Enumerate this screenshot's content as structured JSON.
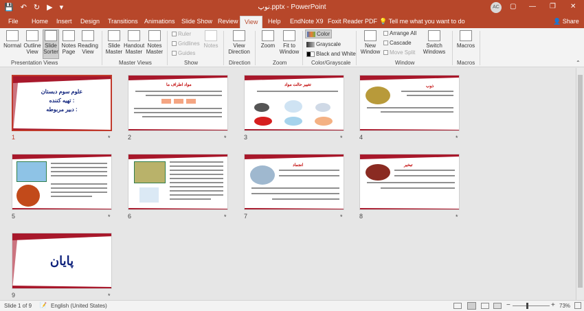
{
  "titlebar": {
    "title": "نوپ.pptx - PowerPoint",
    "user_initials": "AC",
    "minimize": "—",
    "restore": "❐",
    "close": "✕"
  },
  "tabs": {
    "items": [
      "File",
      "Home",
      "Insert",
      "Design",
      "Transitions",
      "Animations",
      "Slide Show",
      "Review",
      "View",
      "Help",
      "EndNote X9",
      "Foxit Reader PDF"
    ],
    "active": "View",
    "tell_me": "Tell me what you want to do",
    "share": "Share"
  },
  "ribbon": {
    "presentation_views": {
      "label": "Presentation Views",
      "buttons": [
        "Normal",
        "Outline View",
        "Slide Sorter",
        "Notes Page",
        "Reading View"
      ]
    },
    "master_views": {
      "label": "Master Views",
      "buttons": [
        "Slide Master",
        "Handout Master",
        "Notes Master"
      ]
    },
    "show": {
      "label": "Show",
      "items": [
        "Ruler",
        "Gridlines",
        "Guides"
      ],
      "notes": "Notes"
    },
    "direction": {
      "label": "Direction",
      "button": "View Direction"
    },
    "zoom": {
      "label": "Zoom",
      "buttons": [
        "Zoom",
        "Fit to Window"
      ]
    },
    "color": {
      "label": "Color/Grayscale",
      "items": [
        "Color",
        "Grayscale",
        "Black and White"
      ]
    },
    "window": {
      "label": "Window",
      "buttons": [
        "New Window",
        "Switch Windows"
      ],
      "items": [
        "Arrange All",
        "Cascade",
        "Move Split"
      ]
    },
    "macros": {
      "label": "Macros",
      "button": "Macros"
    }
  },
  "slides": [
    {
      "num": "1",
      "lines": [
        "علوم سوم دبستان",
        "تهیه کننده :",
        "دبیر مربوطه :"
      ]
    },
    {
      "num": "2",
      "title": "مواد اطراف ما"
    },
    {
      "num": "3",
      "title": "تغییر حالت مواد"
    },
    {
      "num": "4",
      "title": "ذوب"
    },
    {
      "num": "5"
    },
    {
      "num": "6"
    },
    {
      "num": "7",
      "title": "انجماد"
    },
    {
      "num": "8",
      "title": "تبخیر"
    },
    {
      "num": "9",
      "lines": [
        "پایان"
      ]
    }
  ],
  "star": "*",
  "status": {
    "slide_info": "Slide 1 of 9",
    "language": "English (United States)",
    "zoom": "73%",
    "zoom_level": 0.73
  }
}
